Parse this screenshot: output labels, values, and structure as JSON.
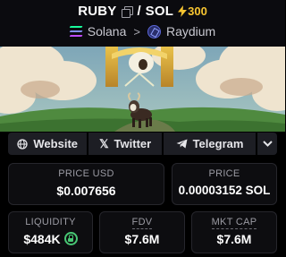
{
  "header": {
    "base_symbol": "RUBY",
    "separator": "/",
    "quote_symbol": "SOL",
    "boost_count": "300",
    "chain": "Solana",
    "dex": "Raydium",
    "boost_color": "#f7c531"
  },
  "banner": {
    "image": "goat-on-hill-with-clouds-illustration"
  },
  "links": {
    "website": "Website",
    "twitter": "Twitter",
    "telegram": "Telegram"
  },
  "stats": {
    "price_usd_label": "PRICE USD",
    "price_usd_value": "$0.007656",
    "price_label": "PRICE",
    "price_value": "0.00003152 SOL",
    "liquidity_label": "LIQUIDITY",
    "liquidity_value": "$484K",
    "fdv_label": "FDV",
    "fdv_value": "$7.6M",
    "mktcap_label": "MKT CAP",
    "mktcap_value": "$7.6M"
  },
  "colors": {
    "accent_green": "#48c774",
    "panel_bg": "#0d0d10",
    "button_bg": "#1d1e24"
  }
}
